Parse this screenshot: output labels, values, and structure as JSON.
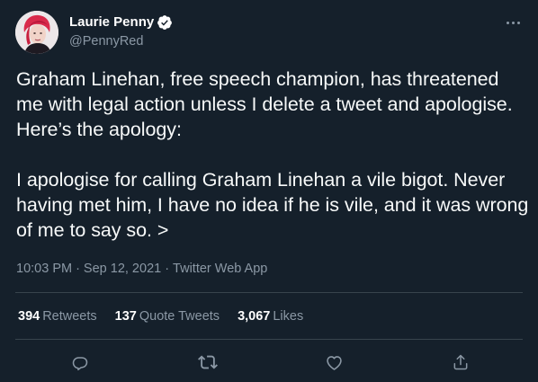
{
  "tweet": {
    "author": {
      "display_name": "Laurie Penny",
      "handle": "@PennyRed",
      "verified": true,
      "avatar_icon": "avatar-photo"
    },
    "text": {
      "paragraph_1": "Graham Linehan, free speech champion, has threatened me with legal action unless I delete a tweet and apologise. Here’s the apology:",
      "paragraph_2": "I apologise for calling Graham Linehan a vile bigot. Never having met him, I have no idea if he is vile, and it was wrong of me to say so. >"
    },
    "meta": {
      "time": "10:03 PM",
      "date": "Sep 12, 2021",
      "source": "Twitter Web App",
      "separator": "·"
    },
    "stats": {
      "retweets_count": "394",
      "retweets_label": "Retweets",
      "quotes_count": "137",
      "quotes_label": "Quote Tweets",
      "likes_count": "3,067",
      "likes_label": "Likes"
    },
    "actions": [
      "reply-icon",
      "retweet-icon",
      "like-icon",
      "share-icon"
    ]
  },
  "colors": {
    "background": "#15202b",
    "text": "#f7f9f9",
    "secondary": "#8b98a5",
    "divider": "#38444d",
    "verified": "#ffffff"
  }
}
